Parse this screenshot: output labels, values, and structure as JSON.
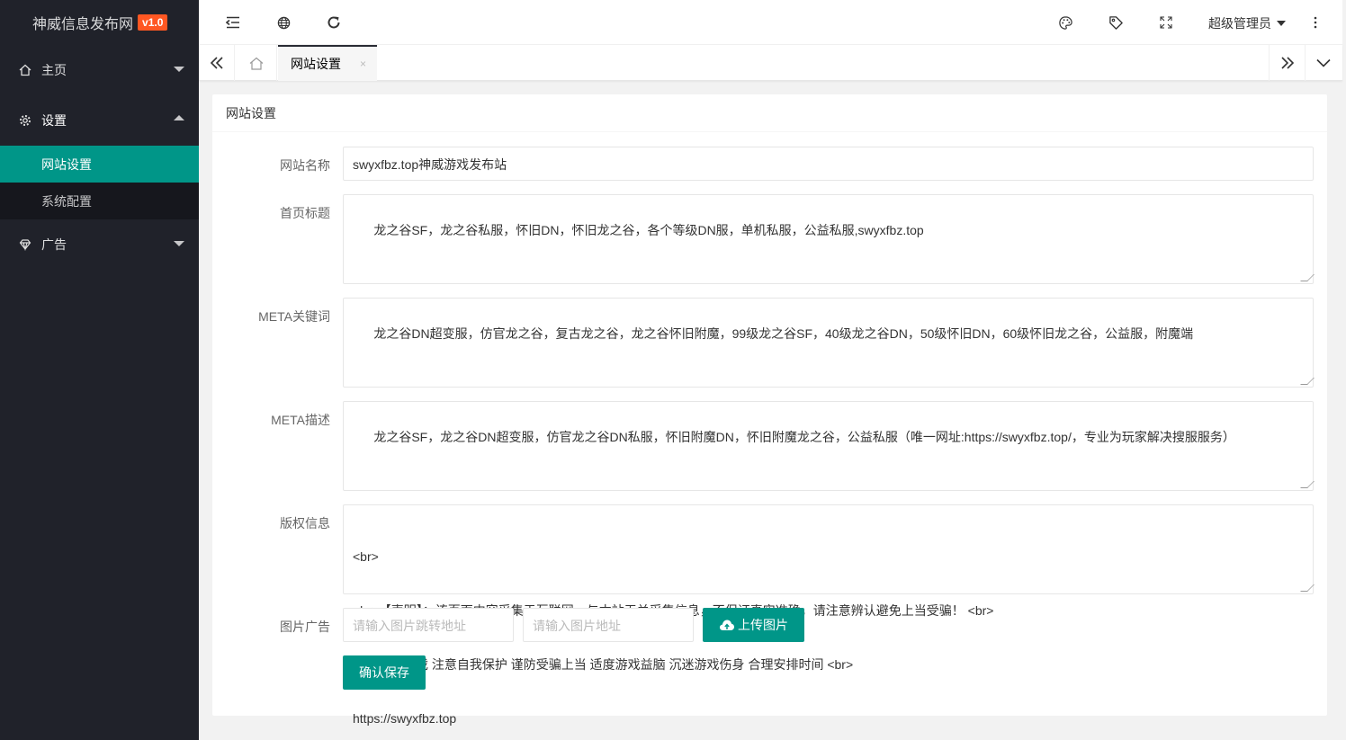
{
  "brand": {
    "name": "神威信息发布网",
    "version": "v1.0"
  },
  "sidebar": {
    "items": [
      {
        "label": "主页"
      },
      {
        "label": "设置",
        "children": [
          {
            "label": "网站设置",
            "active": true
          },
          {
            "label": "系统配置"
          }
        ]
      },
      {
        "label": "广告"
      }
    ]
  },
  "header": {
    "user": "超级管理员"
  },
  "tabs": {
    "active": "网站设置",
    "close": "×"
  },
  "form": {
    "title": "网站设置",
    "site_name": {
      "label": "网站名称",
      "value": "swyxfbz.top神威游戏发布站"
    },
    "home_title": {
      "label": "首页标题",
      "value": "龙之谷SF，龙之谷私服，怀旧DN，怀旧龙之谷，各个等级DN服，单机私服，公益私服,swyxfbz.top"
    },
    "meta_keywords": {
      "label": "META关键词",
      "value": "龙之谷DN超变服，仿官龙之谷，复古龙之谷，龙之谷怀旧附魔，99级龙之谷SF，40级龙之谷DN，50级怀旧DN，60级怀旧龙之谷，公益服，附魔端"
    },
    "meta_desc": {
      "label": "META描述",
      "value": "龙之谷SF，龙之谷DN超变服，仿官龙之谷DN私服，怀旧附魔DN，怀旧附魔龙之谷，公益私服（唯一网址:https://swyxfbz.top/，专业为玩家解决搜服服务）"
    },
    "copyright": {
      "label": "版权信息",
      "lines": [
        "<br>",
        "<br>【声明】：该页面内容采集于互联网，与本站无关采集信息，不保证真实准确，请注意辨认避免上当受骗！ <br>",
        "拒绝盗版游戏 注意自我保护 谨防受骗上当 适度游戏益脑 沉迷游戏伤身 合理安排时间 <br>",
        "https://swyxfbz.top"
      ]
    },
    "image_ad": {
      "label": "图片广告",
      "link_placeholder": "请输入图片跳转地址",
      "url_placeholder": "请输入图片地址",
      "upload_label": "上传图片"
    },
    "save_label": "确认保存"
  },
  "colors": {
    "accent": "#009688",
    "sidebar_bg": "#20222a",
    "badge": "#ff5722"
  }
}
